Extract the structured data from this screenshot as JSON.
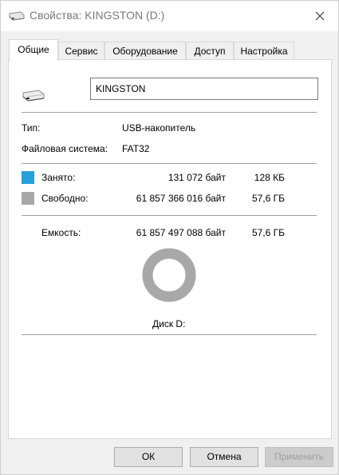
{
  "window": {
    "title": "Свойства: KINGSTON (D:)"
  },
  "tabs": [
    {
      "label": "Общие",
      "active": true
    },
    {
      "label": "Сервис"
    },
    {
      "label": "Оборудование"
    },
    {
      "label": "Доступ"
    },
    {
      "label": "Настройка"
    }
  ],
  "general": {
    "volume_name": "KINGSTON",
    "type_label": "Тип:",
    "type_value": "USB-накопитель",
    "fs_label": "Файловая система:",
    "fs_value": "FAT32",
    "used": {
      "label": "Занято:",
      "bytes": "131 072 байт",
      "size": "128 КБ",
      "color": "#26a0da"
    },
    "free": {
      "label": "Свободно:",
      "bytes": "61 857 366 016 байт",
      "size": "57,6 ГБ",
      "color": "#a8a8a8"
    },
    "capacity": {
      "label": "Емкость:",
      "bytes": "61 857 497 088 байт",
      "size": "57,6 ГБ"
    },
    "disk_label": "Диск D:",
    "used_fraction": 2.1e-06
  },
  "buttons": {
    "ok": "ОК",
    "cancel": "Отмена",
    "apply": "Применить"
  },
  "icons": {
    "window": "usb-drive-icon",
    "drive": "usb-drive-icon",
    "close": "close-icon"
  }
}
